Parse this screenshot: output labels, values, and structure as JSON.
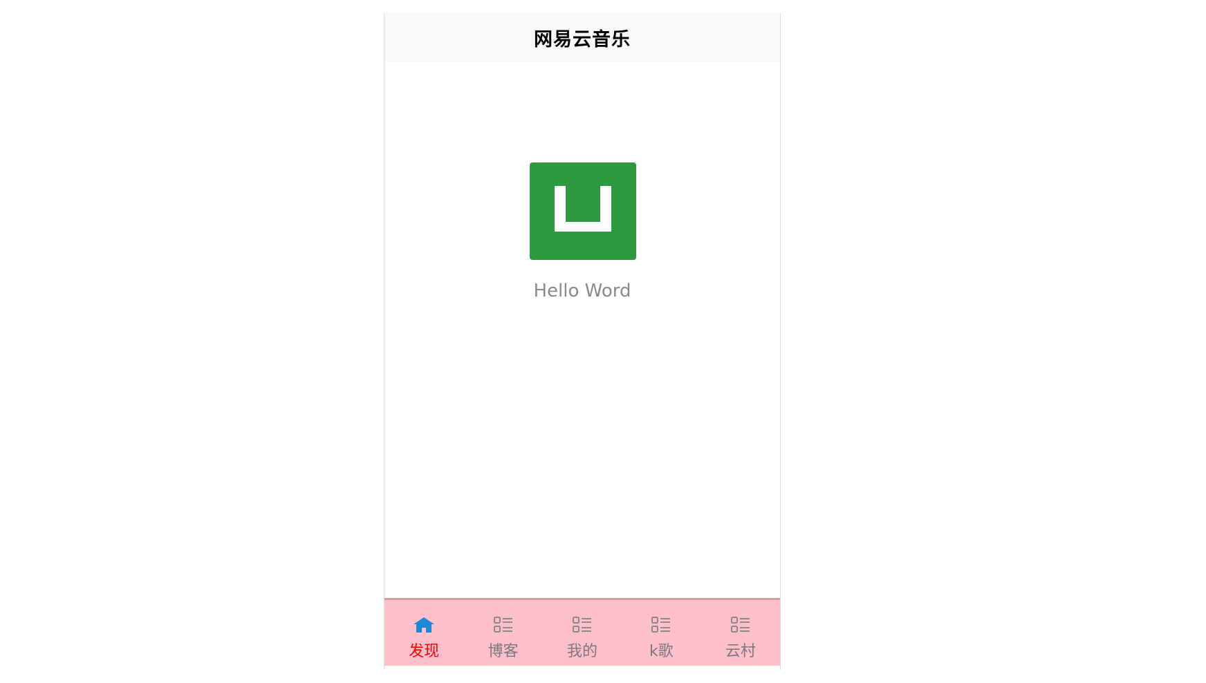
{
  "navbar": {
    "title": "网易云音乐"
  },
  "main": {
    "logo_icon": "uniapp-logo-icon",
    "greeting": "Hello Word"
  },
  "tabbar": {
    "active_color": "#ff0000",
    "inactive_color": "#7a7a7a",
    "background": "#ffc0cb",
    "items": [
      {
        "label": "发现",
        "icon": "home-icon",
        "active": true
      },
      {
        "label": "博客",
        "icon": "list-icon",
        "active": false
      },
      {
        "label": "我的",
        "icon": "list-icon",
        "active": false
      },
      {
        "label": "k歌",
        "icon": "list-icon",
        "active": false
      },
      {
        "label": "云村",
        "icon": "list-icon",
        "active": false
      }
    ]
  }
}
